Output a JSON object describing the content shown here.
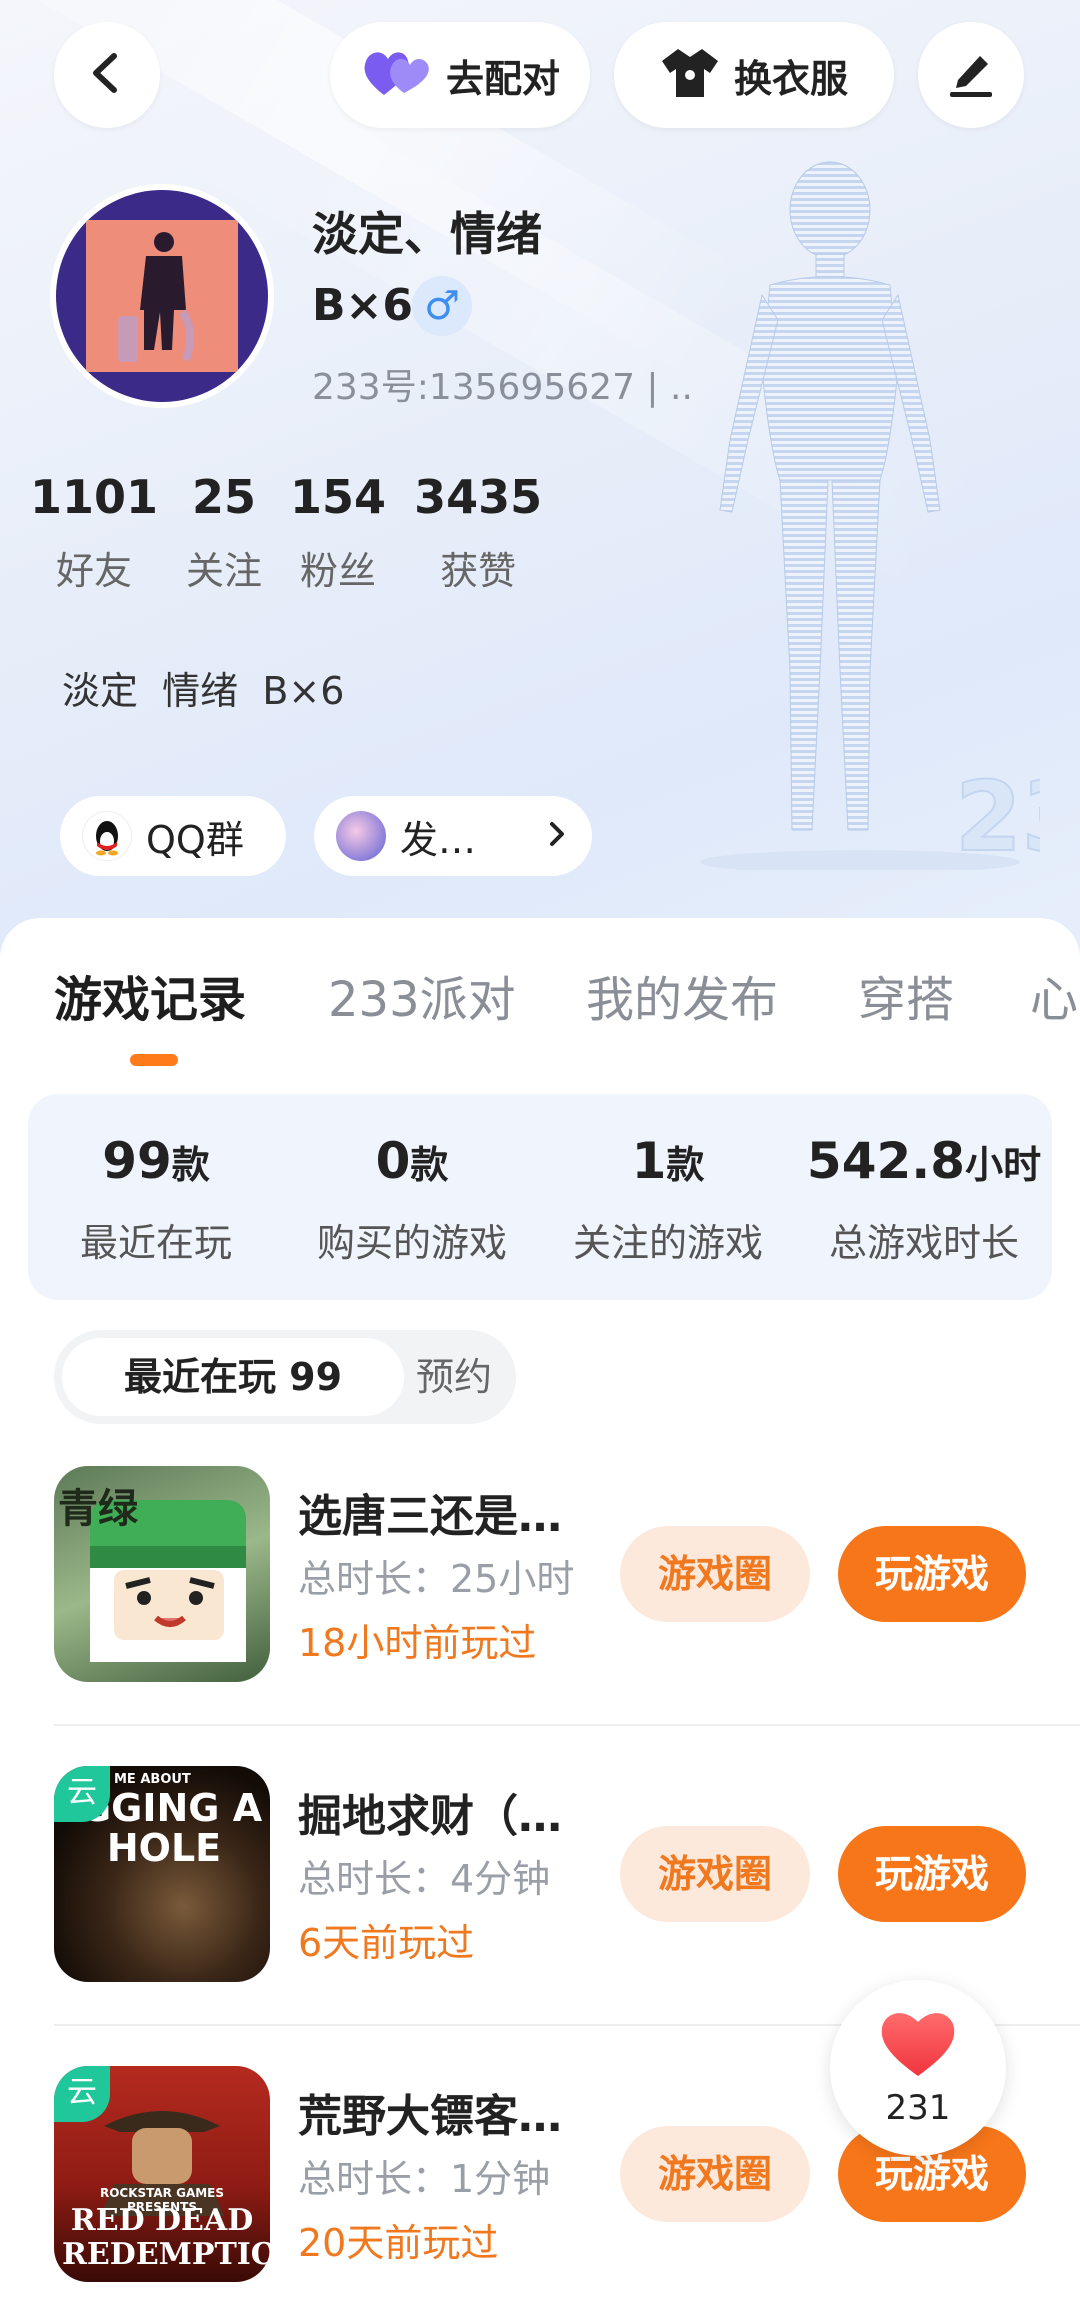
{
  "header": {
    "match_label": "去配对",
    "outfit_label": "换衣服"
  },
  "profile": {
    "nickname": "淡定、情绪",
    "sub_name": "B×6",
    "gender_symbol": "♂",
    "uid": "233号:135695627 | ..",
    "bio": "淡定  情绪  B×6"
  },
  "stats": [
    {
      "value": "1101",
      "label": "好友"
    },
    {
      "value": "25",
      "label": "关注"
    },
    {
      "value": "154",
      "label": "粉丝"
    },
    {
      "value": "3435",
      "label": "获赞"
    }
  ],
  "chips": {
    "qq_group": "QQ群",
    "post": "发…"
  },
  "tabs": [
    "游戏记录",
    "233派对",
    "我的发布",
    "穿搭",
    "心"
  ],
  "summary": [
    {
      "value": "99",
      "unit": "款",
      "label": "最近在玩"
    },
    {
      "value": "0",
      "unit": "款",
      "label": "购买的游戏"
    },
    {
      "value": "1",
      "unit": "款",
      "label": "关注的游戏"
    },
    {
      "value": "542.8",
      "unit": "小时",
      "label": "总游戏时长"
    }
  ],
  "segment": {
    "recent": "最近在玩 99",
    "reserve": "预约"
  },
  "games": [
    {
      "title": "选唐三还是…",
      "duration": "总时长：25小时",
      "last_played": "18小时前玩过",
      "circle_label": "游戏圈",
      "play_label": "玩游戏",
      "thumb_text": "青绿",
      "cloud": ""
    },
    {
      "title": "掘地求财（…",
      "duration": "总时长：4分钟",
      "last_played": "6天前玩过",
      "circle_label": "游戏圈",
      "play_label": "玩游戏",
      "thumb_text": "IGGING A HOLE",
      "thumb_small": "ME ABOUT",
      "cloud": "云"
    },
    {
      "title": "荒野大镖客…",
      "duration": "总时长：1分钟",
      "last_played": "20天前玩过",
      "circle_label": "游戏圈",
      "play_label": "玩游戏",
      "thumb_text": "RED DEAD REDEMPTION",
      "thumb_small": "ROCKSTAR GAMES PRESENTS",
      "cloud": "云"
    }
  ],
  "likes": {
    "count": "231"
  },
  "colors": {
    "accent": "#f7761a",
    "accent_light": "#fde9dc",
    "cloud_badge": "#1fc79a",
    "summary_bg": "#f0f5fd"
  }
}
